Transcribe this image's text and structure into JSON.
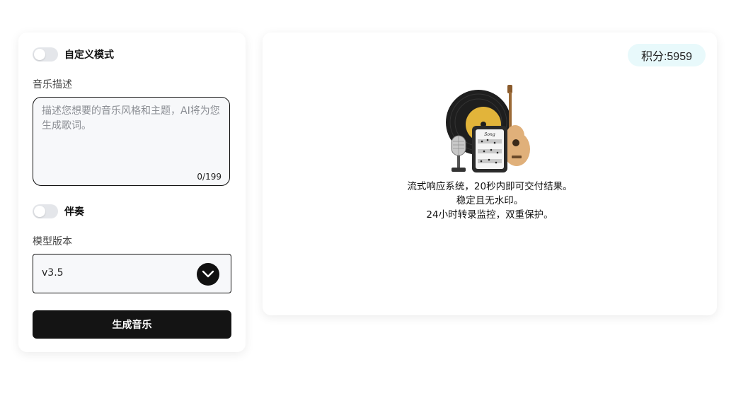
{
  "form": {
    "custom_mode_label": "自定义模式",
    "music_desc_label": "音乐描述",
    "textarea_placeholder": "描述您想要的音乐风格和主题，AI将为您生成歌词。",
    "textarea_value": "",
    "char_counter": "0/199",
    "accompaniment_label": "伴奏",
    "model_version_label": "模型版本",
    "model_version_value": "v3.5",
    "generate_button": "生成音乐"
  },
  "result": {
    "points_badge": "积分:5959",
    "info_lines": [
      "流式响应系统，20秒内即可交付结果。",
      "稳定且无水印。",
      "24小时转录监控，双重保护。"
    ],
    "illustration_text": "Song"
  },
  "colors": {
    "accent_dark": "#141414",
    "badge_bg": "#e8f9fb",
    "toggle_off": "#e4e6ea",
    "vinyl_gold": "#e2b43a"
  },
  "icons": {
    "select_arrow": "chevron-down-icon",
    "illustration": "music-instruments-illustration"
  }
}
